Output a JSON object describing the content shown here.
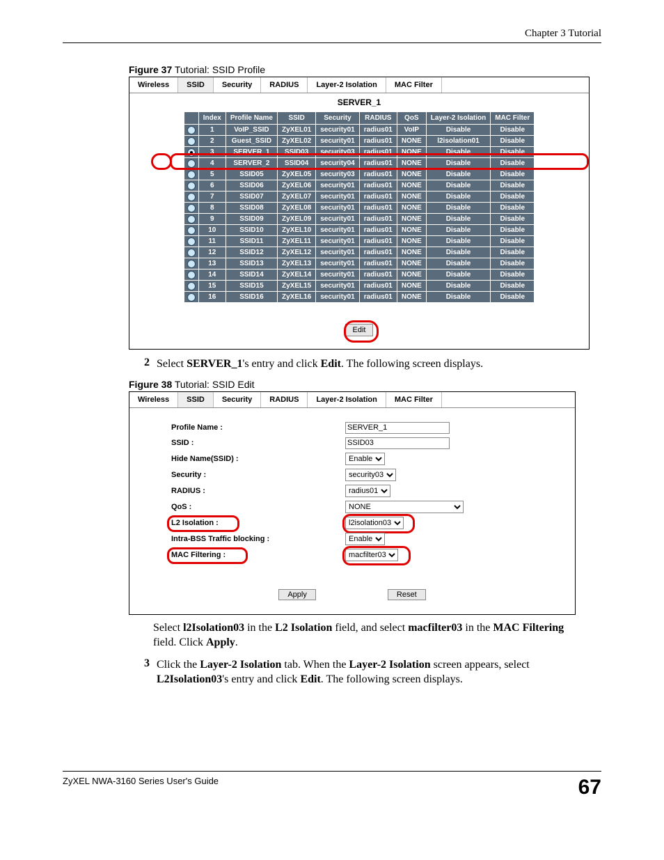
{
  "header": {
    "chapter": "Chapter 3 Tutorial"
  },
  "fig37": {
    "caption_bold": "Figure 37",
    "caption_rest": "   Tutorial: SSID Profile",
    "tabs": [
      "Wireless",
      "SSID",
      "Security",
      "RADIUS",
      "Layer-2 Isolation",
      "MAC Filter"
    ],
    "active_tab": "SSID",
    "subtitle": "SERVER_1",
    "columns": [
      "",
      "Index",
      "Profile Name",
      "SSID",
      "Security",
      "RADIUS",
      "QoS",
      "Layer-2 Isolation",
      "MAC Filter"
    ],
    "rows": [
      {
        "sel": false,
        "idx": "1",
        "name": "VoIP_SSID",
        "ssid": "ZyXEL01",
        "sec": "security01",
        "rad": "radius01",
        "qos": "VoIP",
        "l2": "Disable",
        "mac": "Disable"
      },
      {
        "sel": false,
        "idx": "2",
        "name": "Guest_SSID",
        "ssid": "ZyXEL02",
        "sec": "security01",
        "rad": "radius01",
        "qos": "NONE",
        "l2": "l2isolation01",
        "mac": "Disable"
      },
      {
        "sel": true,
        "idx": "3",
        "name": "SERVER_1",
        "ssid": "SSID03",
        "sec": "security03",
        "rad": "radius01",
        "qos": "NONE",
        "l2": "Disable",
        "mac": "Disable"
      },
      {
        "sel": false,
        "idx": "4",
        "name": "SERVER_2",
        "ssid": "SSID04",
        "sec": "security04",
        "rad": "radius01",
        "qos": "NONE",
        "l2": "Disable",
        "mac": "Disable"
      },
      {
        "sel": false,
        "idx": "5",
        "name": "SSID05",
        "ssid": "ZyXEL05",
        "sec": "security03",
        "rad": "radius01",
        "qos": "NONE",
        "l2": "Disable",
        "mac": "Disable"
      },
      {
        "sel": false,
        "idx": "6",
        "name": "SSID06",
        "ssid": "ZyXEL06",
        "sec": "security01",
        "rad": "radius01",
        "qos": "NONE",
        "l2": "Disable",
        "mac": "Disable"
      },
      {
        "sel": false,
        "idx": "7",
        "name": "SSID07",
        "ssid": "ZyXEL07",
        "sec": "security01",
        "rad": "radius01",
        "qos": "NONE",
        "l2": "Disable",
        "mac": "Disable"
      },
      {
        "sel": false,
        "idx": "8",
        "name": "SSID08",
        "ssid": "ZyXEL08",
        "sec": "security01",
        "rad": "radius01",
        "qos": "NONE",
        "l2": "Disable",
        "mac": "Disable"
      },
      {
        "sel": false,
        "idx": "9",
        "name": "SSID09",
        "ssid": "ZyXEL09",
        "sec": "security01",
        "rad": "radius01",
        "qos": "NONE",
        "l2": "Disable",
        "mac": "Disable"
      },
      {
        "sel": false,
        "idx": "10",
        "name": "SSID10",
        "ssid": "ZyXEL10",
        "sec": "security01",
        "rad": "radius01",
        "qos": "NONE",
        "l2": "Disable",
        "mac": "Disable"
      },
      {
        "sel": false,
        "idx": "11",
        "name": "SSID11",
        "ssid": "ZyXEL11",
        "sec": "security01",
        "rad": "radius01",
        "qos": "NONE",
        "l2": "Disable",
        "mac": "Disable"
      },
      {
        "sel": false,
        "idx": "12",
        "name": "SSID12",
        "ssid": "ZyXEL12",
        "sec": "security01",
        "rad": "radius01",
        "qos": "NONE",
        "l2": "Disable",
        "mac": "Disable"
      },
      {
        "sel": false,
        "idx": "13",
        "name": "SSID13",
        "ssid": "ZyXEL13",
        "sec": "security01",
        "rad": "radius01",
        "qos": "NONE",
        "l2": "Disable",
        "mac": "Disable"
      },
      {
        "sel": false,
        "idx": "14",
        "name": "SSID14",
        "ssid": "ZyXEL14",
        "sec": "security01",
        "rad": "radius01",
        "qos": "NONE",
        "l2": "Disable",
        "mac": "Disable"
      },
      {
        "sel": false,
        "idx": "15",
        "name": "SSID15",
        "ssid": "ZyXEL15",
        "sec": "security01",
        "rad": "radius01",
        "qos": "NONE",
        "l2": "Disable",
        "mac": "Disable"
      },
      {
        "sel": false,
        "idx": "16",
        "name": "SSID16",
        "ssid": "ZyXEL16",
        "sec": "security01",
        "rad": "radius01",
        "qos": "NONE",
        "l2": "Disable",
        "mac": "Disable"
      }
    ],
    "edit_label": "Edit"
  },
  "step2": {
    "num": "2",
    "text_pre": "Select ",
    "bold1": "SERVER_1",
    "mid": "'s entry and click ",
    "bold2": "Edit",
    "post": ". The following screen displays."
  },
  "fig38": {
    "caption_bold": "Figure 38",
    "caption_rest": "   Tutorial: SSID Edit",
    "tabs": [
      "Wireless",
      "SSID",
      "Security",
      "RADIUS",
      "Layer-2 Isolation",
      "MAC Filter"
    ],
    "active_tab": "SSID",
    "fields": {
      "profile_name": {
        "label": "Profile Name :",
        "value": "SERVER_1"
      },
      "ssid": {
        "label": "SSID :",
        "value": "SSID03"
      },
      "hide": {
        "label": "Hide Name(SSID) :",
        "value": "Enable"
      },
      "security": {
        "label": "Security :",
        "value": "security03"
      },
      "radius": {
        "label": "RADIUS :",
        "value": "radius01"
      },
      "qos": {
        "label": "QoS :",
        "value": "NONE"
      },
      "l2": {
        "label": "L2 Isolation :",
        "value": "l2isolation03"
      },
      "intra": {
        "label": "Intra-BSS Traffic blocking :",
        "value": "Enable"
      },
      "mac": {
        "label": "MAC Filtering :",
        "value": "macfilter03"
      }
    },
    "apply_label": "Apply",
    "reset_label": "Reset"
  },
  "para1": {
    "t1": "Select ",
    "b1": "l2Isolation03",
    "t2": " in the ",
    "b2": "L2 Isolation",
    "t3": " field, and select ",
    "b3": "macfilter03",
    "t4": " in the ",
    "b4": "MAC Filtering",
    "t5": " field. Click ",
    "b5": "Apply",
    "t6": "."
  },
  "step3": {
    "num": "3",
    "t1": "Click the ",
    "b1": "Layer-2 Isolation",
    "t2": " tab. When the ",
    "b2": "Layer-2 Isolation",
    "t3": " screen appears, select ",
    "b3": "L2Isolation03",
    "t4": "'s entry and click ",
    "b4": "Edit",
    "t5": ". The following screen displays."
  },
  "footer": {
    "guide": "ZyXEL NWA-3160 Series User's Guide",
    "page": "67"
  }
}
